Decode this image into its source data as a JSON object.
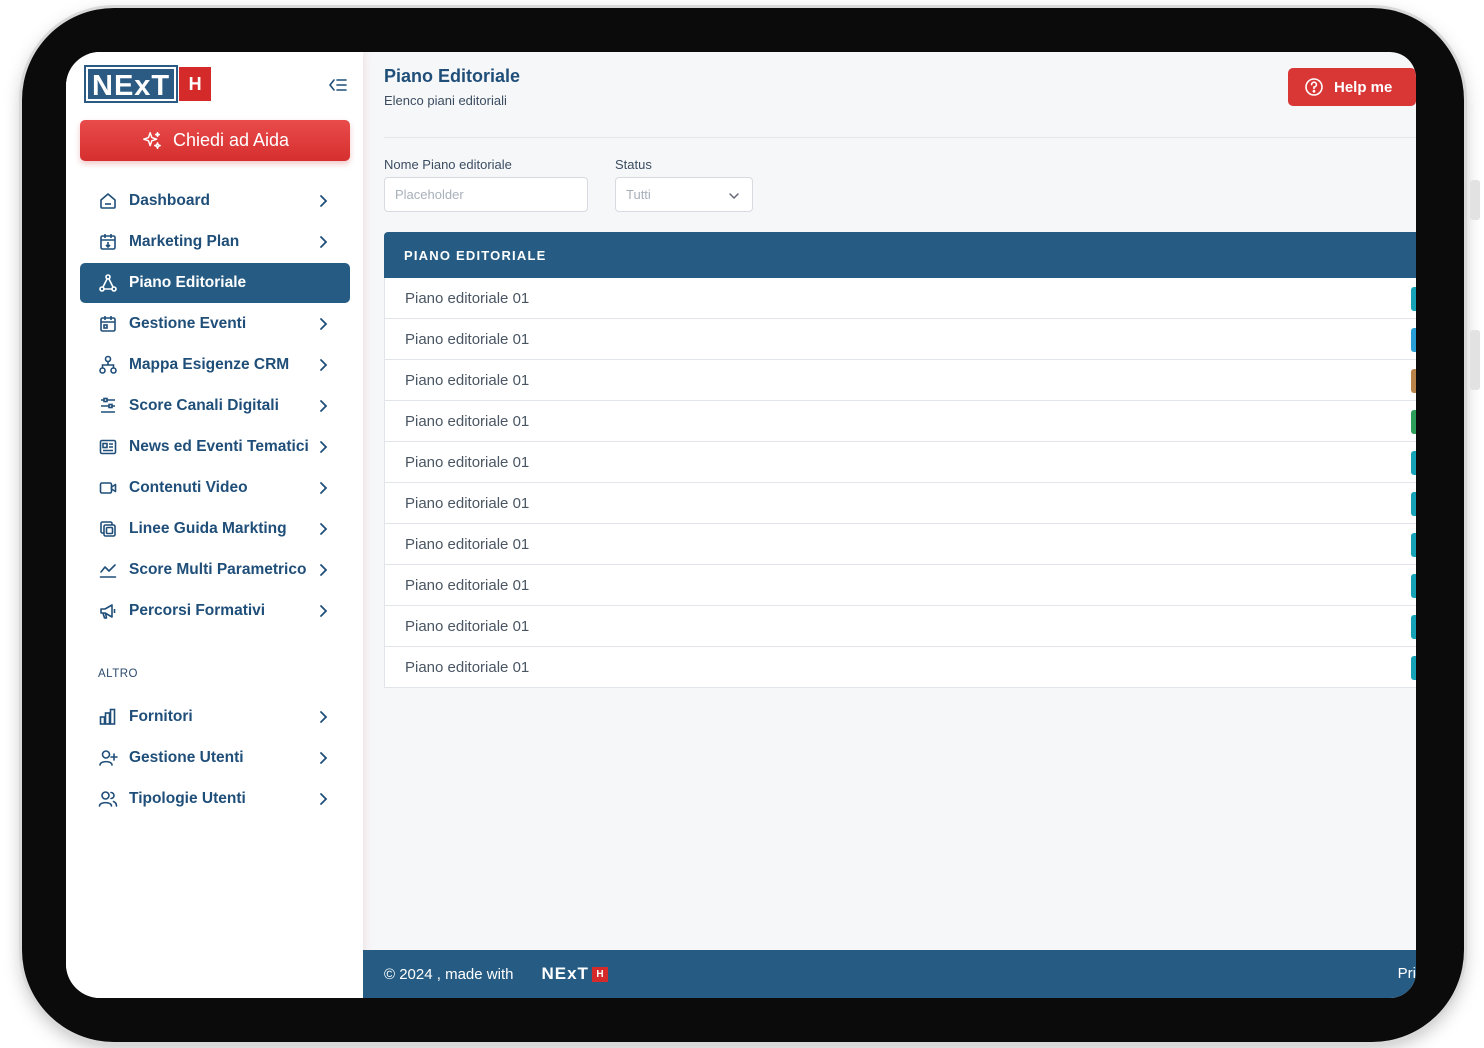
{
  "sidebar": {
    "logo_text": "NExT",
    "logo_badge": "H",
    "aida_label": "Chiedi ad Aida",
    "items": [
      {
        "label": "Dashboard",
        "icon": "home-icon"
      },
      {
        "label": "Marketing Plan",
        "icon": "calendar-icon"
      },
      {
        "label": "Piano Editoriale",
        "icon": "network-icon",
        "active": true
      },
      {
        "label": "Gestione Eventi",
        "icon": "calendar-event-icon"
      },
      {
        "label": "Mappa Esigenze CRM",
        "icon": "hierarchy-icon"
      },
      {
        "label": "Score Canali Digitali",
        "icon": "sliders-icon"
      },
      {
        "label": "News ed Eventi Tematici",
        "icon": "newspaper-icon"
      },
      {
        "label": "Contenuti Video",
        "icon": "video-icon"
      },
      {
        "label": "Linee Guida Markting",
        "icon": "copy-icon"
      },
      {
        "label": "Score Multi Parametrico",
        "icon": "chart-line-icon"
      },
      {
        "label": "Percorsi Formativi",
        "icon": "megaphone-icon"
      }
    ],
    "section_label": "ALTRO",
    "other_items": [
      {
        "label": "Fornitori",
        "icon": "bar-chart-icon"
      },
      {
        "label": "Gestione Utenti",
        "icon": "user-plus-icon"
      },
      {
        "label": "Tipologie Utenti",
        "icon": "users-icon"
      }
    ]
  },
  "header": {
    "title": "Piano Editoriale",
    "subtitle": "Elenco piani editoriali",
    "help_label": "Help me"
  },
  "filters": {
    "name_label": "Nome Piano editoriale",
    "name_placeholder": "Placeholder",
    "status_label": "Status",
    "status_value": "Tutti"
  },
  "table": {
    "header": "PIANO EDITORIALE",
    "rows": [
      {
        "name": "Piano editoriale 01",
        "badge_color": "#16a3b8"
      },
      {
        "name": "Piano editoriale 01",
        "badge_color": "#2a9fd6"
      },
      {
        "name": "Piano editoriale 01",
        "badge_color": "#b8844a"
      },
      {
        "name": "Piano editoriale 01",
        "badge_color": "#2e9e5b"
      },
      {
        "name": "Piano editoriale 01",
        "badge_color": "#16a3b8"
      },
      {
        "name": "Piano editoriale 01",
        "badge_color": "#16a3b8"
      },
      {
        "name": "Piano editoriale 01",
        "badge_color": "#16a3b8"
      },
      {
        "name": "Piano editoriale 01",
        "badge_color": "#16a3b8"
      },
      {
        "name": "Piano editoriale 01",
        "badge_color": "#16a3b8"
      },
      {
        "name": "Piano editoriale 01",
        "badge_color": "#16a3b8"
      }
    ]
  },
  "footer": {
    "copyright": "© 2024 , made with",
    "logo_text": "NExT",
    "logo_badge": "H",
    "right_text": "Pri"
  },
  "colors": {
    "brand_blue": "#265c84",
    "brand_red": "#d93636"
  }
}
